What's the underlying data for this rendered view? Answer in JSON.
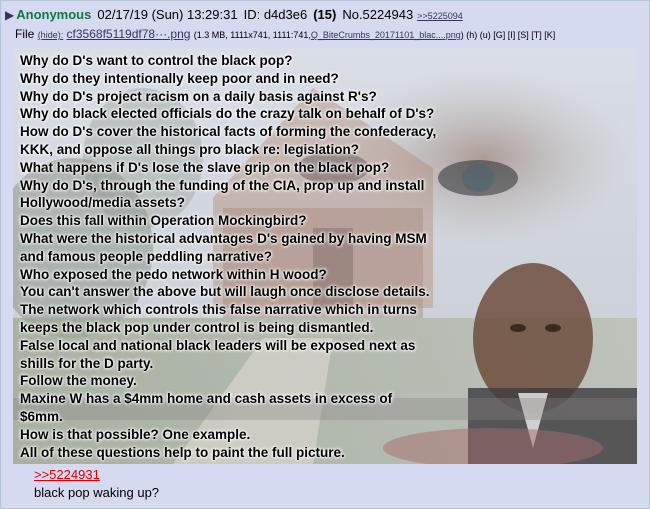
{
  "post": {
    "arrow": "▶",
    "name": "Anonymous",
    "datetime": "02/17/19 (Sun) 13:29:31",
    "id_label": "ID: d4d3e6",
    "post_count": "(15)",
    "post_number": "No.5224943",
    "backlink": ">>5225094"
  },
  "file": {
    "label": "File",
    "hide": "(hide):",
    "filename": "cf3568f5119df78···.png",
    "meta": "(1.3 MB, 1111x741, 1111:741,",
    "original_name": "Q_BiteCrumbs_20171101_blac....png",
    "links": ") (h) (u) [G] [I] [S] [T] [K]"
  },
  "image_text": [
    "Why do D's want to control the black pop?",
    "Why do they intentionally keep poor and in need?",
    "Why do D's project racism on a daily basis against R's?",
    "Why do black elected officials do the crazy talk on behalf of D's?",
    "How do D's cover the historical facts of forming the confederacy,",
    "KKK, and oppose all things pro black re: legislation?",
    "What happens if D's lose the slave grip on the black pop?",
    "Why do D's, through the funding of the CIA, prop up and install",
    "Hollywood/media assets?",
    "Does this fall within Operation Mockingbird?",
    "What were the historical advantages D's gained by having MSM",
    "and famous people peddling narrative?",
    "Who exposed the pedo network within H wood?",
    "You can't answer the above but will laugh once disclose details.",
    "The network which controls this false narrative which in turns",
    "keeps the black pop under control is being dismantled.",
    "False local and national black leaders will be exposed next as",
    "shills for the D party.",
    "Follow the money.",
    "Maxine W has a $4mm home and cash assets in excess of",
    "$6mm.",
    "How is that possible? One example.",
    "All of these questions help to paint the full picture."
  ],
  "reply": {
    "quotelink": ">>5224931",
    "text": "black pop waking up?"
  }
}
